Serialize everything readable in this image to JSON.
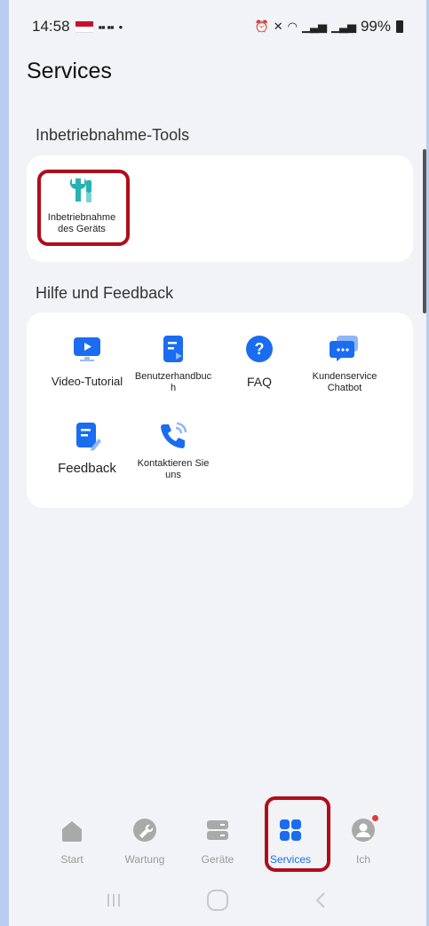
{
  "status_bar": {
    "time": "14:58",
    "battery": "99%"
  },
  "header": {
    "title": "Services"
  },
  "sections": {
    "tools": {
      "title": "Inbetriebnahme-Tools",
      "items": [
        {
          "label": "Inbetriebnahme des Geräts",
          "icon": "wrench-screwdriver-icon"
        }
      ]
    },
    "help": {
      "title": "Hilfe und Feedback",
      "items": [
        {
          "label": "Video-Tutorial",
          "icon": "video-play-icon"
        },
        {
          "label": "Benutzerhandbuch",
          "icon": "manual-icon"
        },
        {
          "label": "FAQ",
          "icon": "question-icon"
        },
        {
          "label": "Kundenservice Chatbot",
          "icon": "chat-icon"
        },
        {
          "label": "Feedback",
          "icon": "feedback-icon"
        },
        {
          "label": "Kontaktieren Sie uns",
          "icon": "phone-icon"
        }
      ]
    }
  },
  "tabbar": {
    "items": [
      {
        "label": "Start",
        "icon": "home-icon"
      },
      {
        "label": "Wartung",
        "icon": "wrench-icon"
      },
      {
        "label": "Geräte",
        "icon": "devices-icon"
      },
      {
        "label": "Services",
        "icon": "grid-icon",
        "active": true
      },
      {
        "label": "Ich",
        "icon": "profile-icon"
      }
    ]
  },
  "colors": {
    "accent": "#1a6cf0",
    "teal": "#27b3b5",
    "highlight": "#b00d1a"
  }
}
